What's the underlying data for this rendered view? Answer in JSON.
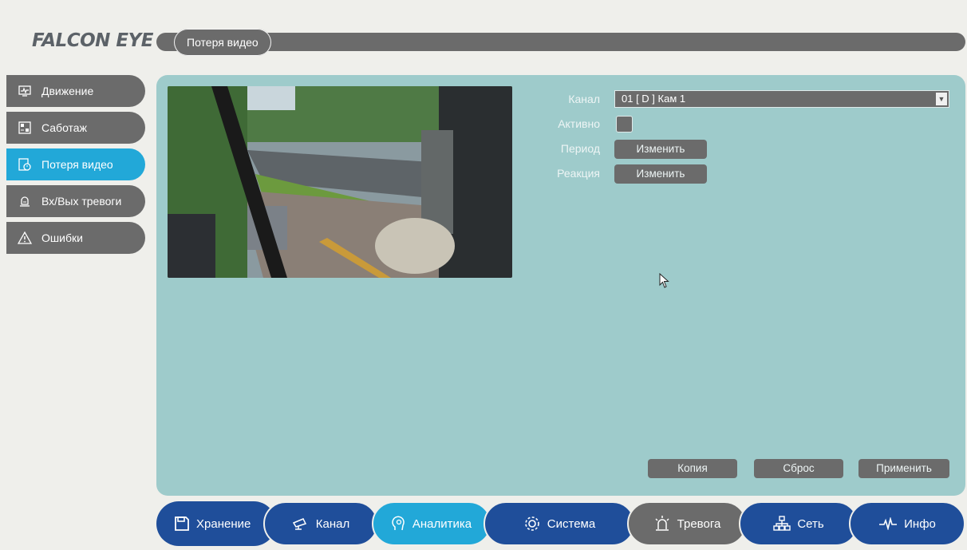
{
  "brand": {
    "logo": "FALCON EYE"
  },
  "header": {
    "title": "Потеря видео"
  },
  "sidebar": {
    "items": [
      {
        "label": "Движение",
        "icon": "motion-icon"
      },
      {
        "label": "Саботаж",
        "icon": "tamper-icon"
      },
      {
        "label": "Потеря видео",
        "icon": "video-loss-icon",
        "active": true
      },
      {
        "label": "Вх/Вых тревоги",
        "icon": "alarm-io-icon"
      },
      {
        "label": "Ошибки",
        "icon": "warning-icon"
      }
    ]
  },
  "form": {
    "channel_label": "Канал",
    "channel_value": "01 [ D ] Кам 1",
    "active_label": "Активно",
    "active_checked": false,
    "period_label": "Период",
    "period_button": "Изменить",
    "reaction_label": "Реакция",
    "reaction_button": "Изменить"
  },
  "actions": {
    "copy": "Копия",
    "reset": "Сброс",
    "apply": "Применить"
  },
  "bottom_nav": [
    {
      "label": "Хранение",
      "icon": "floppy-icon",
      "color": "#1f4e9a"
    },
    {
      "label": "Канал",
      "icon": "camera-icon",
      "color": "#1f4e9a"
    },
    {
      "label": "Аналитика",
      "icon": "analytics-icon",
      "color": "#22a8d8",
      "active": true
    },
    {
      "label": "Система",
      "icon": "gear-icon",
      "color": "#1f4e9a"
    },
    {
      "label": "Тревога",
      "icon": "alarm-icon",
      "color": "#6b6b6b"
    },
    {
      "label": "Сеть",
      "icon": "network-icon",
      "color": "#1f4e9a"
    },
    {
      "label": "Инфо",
      "icon": "pulse-icon",
      "color": "#1f4e9a"
    }
  ],
  "colors": {
    "accent": "#22a8d8",
    "panel": "#9ecbcb",
    "control_gray": "#6b6b6b",
    "nav_blue": "#1f4e9a"
  }
}
